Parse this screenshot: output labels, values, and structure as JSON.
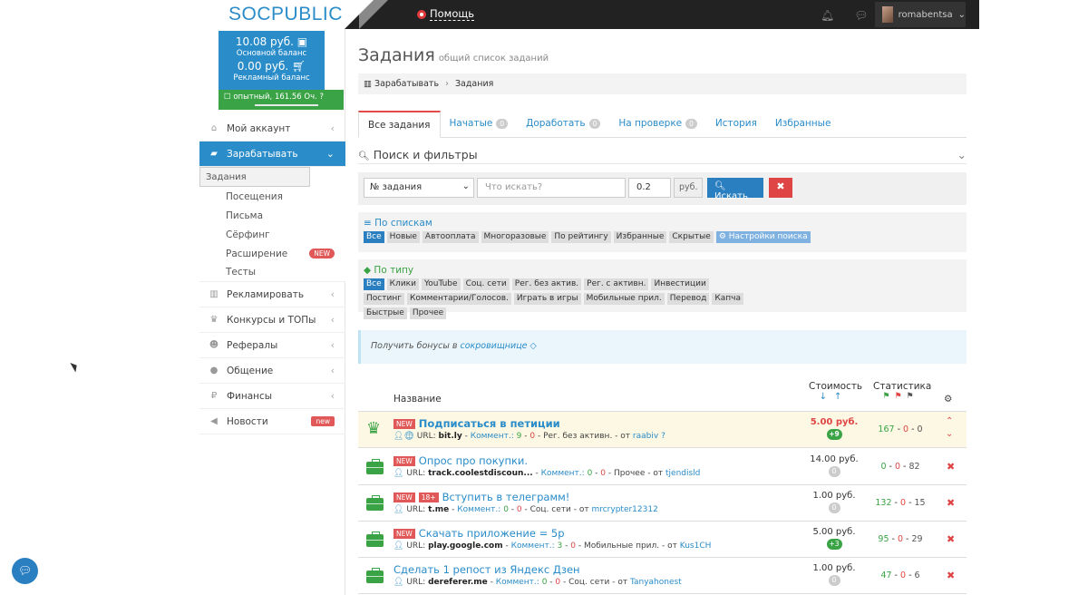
{
  "header": {
    "logo_a": "SOC",
    "logo_b": "PUBLIC",
    "help": "Помощь",
    "username": "romabentsa"
  },
  "balance": {
    "main_value": "10.08 руб.",
    "main_label": "Основной баланс",
    "ad_value": "0.00 руб.",
    "ad_label": "Рекламный баланс",
    "level": "опытный, 161.56 Оч."
  },
  "sidebar": {
    "account": "Мой аккаунт",
    "earn": "Зарабатывать",
    "sub": [
      "Задания",
      "Посещения",
      "Письма",
      "Сёрфинг",
      "Расширение",
      "Тесты"
    ],
    "sub_new": "NEW",
    "advertise": "Рекламировать",
    "contests": "Конкурсы и ТОПы",
    "referrals": "Рефералы",
    "chat": "Общение",
    "finance": "Финансы",
    "news": "Новости",
    "news_badge": "new"
  },
  "main": {
    "title": "Задания",
    "subtitle": "общий список заданий",
    "crumb1": "Зарабатывать",
    "crumb2": "Задания",
    "tabs": [
      {
        "label": "Все задания",
        "count": ""
      },
      {
        "label": "Начатые",
        "count": "0"
      },
      {
        "label": "Доработать",
        "count": "0"
      },
      {
        "label": "На проверке",
        "count": "0"
      },
      {
        "label": "История",
        "count": ""
      },
      {
        "label": "Избранные",
        "count": ""
      }
    ],
    "filter_title": "Поиск и фильтры",
    "select_value": "№ задания",
    "search_placeholder": "Что искать?",
    "price_value": "0.2",
    "currency": "руб.",
    "search_btn": "Искать",
    "lists_title": "По спискам",
    "lists": [
      "Все",
      "Новые",
      "Автооплата",
      "Многоразовые",
      "По рейтингу",
      "Избранные",
      "Скрытые"
    ],
    "search_settings": "Настройки поиска",
    "types_title": "По типу",
    "types": [
      "Все",
      "Клики",
      "YouTube",
      "Соц. сети",
      "Рег. без актив.",
      "Рег. с активн.",
      "Инвестиции",
      "Постинг",
      "Комментарии/Голосов.",
      "Играть в игры",
      "Мобильные прил.",
      "Перевод",
      "Капча",
      "Быстрые",
      "Прочее"
    ],
    "info_text": "Получить бонусы в",
    "info_link": "сокровищнице",
    "col_name": "Название",
    "col_cost": "Стоимость",
    "col_stats": "Статистика"
  },
  "tasks": [
    {
      "title": "Подписаться в петиции",
      "tags": [
        "NEW"
      ],
      "url": "bit.ly",
      "comments_label": "Коммент.:",
      "c1": "9",
      "c2": "0",
      "category": "Рег. без активн.",
      "author": "raabiv",
      "price": "5.00 руб.",
      "pill": "+9",
      "s1": "167",
      "s2": "0",
      "s3": "0"
    },
    {
      "title": "Опрос про покупки.",
      "tags": [
        "NEW"
      ],
      "url": "track.coolestdiscoun...",
      "comments_label": "Коммент.:",
      "c1": "0",
      "c2": "0",
      "category": "Прочее",
      "author": "tjendisld",
      "price": "14.00 руб.",
      "pill": "0",
      "s1": "0",
      "s2": "0",
      "s3": "82"
    },
    {
      "title": "Вступить в телеграмм!",
      "tags": [
        "NEW",
        "18+"
      ],
      "url": "t.me",
      "comments_label": "Коммент.:",
      "c1": "0",
      "c2": "0",
      "category": "Соц. сети",
      "author": "mrcrypter12312",
      "price": "1.00 руб.",
      "pill": "0",
      "s1": "132",
      "s2": "0",
      "s3": "15"
    },
    {
      "title": "Скачать приложение = 5р",
      "tags": [
        "NEW"
      ],
      "url": "play.google.com",
      "comments_label": "Коммент.:",
      "c1": "3",
      "c2": "0",
      "category": "Мобильные прил.",
      "author": "Kus1CH",
      "price": "5.00 руб.",
      "pill": "+3",
      "s1": "95",
      "s2": "0",
      "s3": "29"
    },
    {
      "title": "Сделать 1 репост из Яндекс Дзен",
      "tags": [],
      "url": "dereferer.me",
      "comments_label": "Коммент.:",
      "c1": "0",
      "c2": "0",
      "category": "Соц. сети",
      "author": "Tanyahonest",
      "price": "1.00 руб.",
      "pill": "0",
      "s1": "47",
      "s2": "0",
      "s3": "6"
    }
  ],
  "url_label": "URL:",
  "from_label": "от",
  "colors": {
    "brand": "#2a8cc9",
    "green": "#3aa346",
    "red": "#e04545"
  }
}
